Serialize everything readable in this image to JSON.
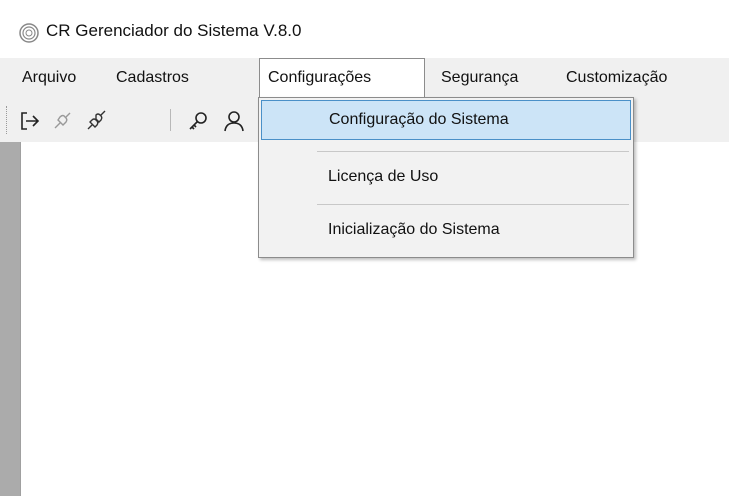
{
  "window": {
    "title": "CR Gerenciador do Sistema V.8.0",
    "icon": "app-logo-icon"
  },
  "menu": {
    "items": [
      {
        "label": "Arquivo"
      },
      {
        "label": "Cadastros"
      },
      {
        "label": "Configurações"
      },
      {
        "label": "Segurança"
      },
      {
        "label": "Customização"
      }
    ],
    "open_index": 2
  },
  "toolbar": {
    "icons": [
      "logout-icon",
      "disconnect-icon",
      "connect-icon",
      "key-icon",
      "user-icon"
    ]
  },
  "dropdown": {
    "items": [
      {
        "label": "Configuração do Sistema",
        "selected": true
      },
      {
        "label": "Licença de Uso",
        "selected": false
      },
      {
        "label": "Inicialização do Sistema",
        "selected": false
      }
    ]
  },
  "colors": {
    "menubar_bg": "#f0f0f0",
    "highlight_bg": "#cce4f7",
    "highlight_border": "#4a90c8",
    "workspace_bg": "#ffffff"
  }
}
